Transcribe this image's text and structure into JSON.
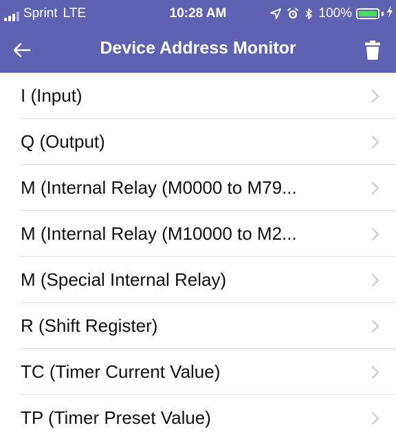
{
  "status_bar": {
    "carrier": "Sprint",
    "network": "LTE",
    "time": "10:28 AM",
    "battery_percent": "100%",
    "icons": [
      "signal-icon",
      "location-arrow-icon",
      "alarm-clock-icon",
      "bluetooth-icon",
      "battery-icon",
      "charging-bolt-icon"
    ]
  },
  "nav": {
    "title": "Device Address Monitor",
    "back_icon": "back-arrow-icon",
    "delete_icon": "trash-icon"
  },
  "colors": {
    "header_background": "#5f62b0",
    "header_text": "#ffffff",
    "battery_fill": "#4cd964",
    "divider": "#dcdcdc",
    "chevron": "#c7c7cc"
  },
  "list": {
    "items": [
      {
        "label": "I (Input)"
      },
      {
        "label": "Q (Output)"
      },
      {
        "label": "M (Internal Relay (M0000 to M79..."
      },
      {
        "label": "M (Internal Relay (M10000 to M2..."
      },
      {
        "label": "M (Special Internal Relay)"
      },
      {
        "label": "R (Shift Register)"
      },
      {
        "label": "TC (Timer Current Value)"
      },
      {
        "label": "TP (Timer Preset Value)"
      }
    ]
  }
}
